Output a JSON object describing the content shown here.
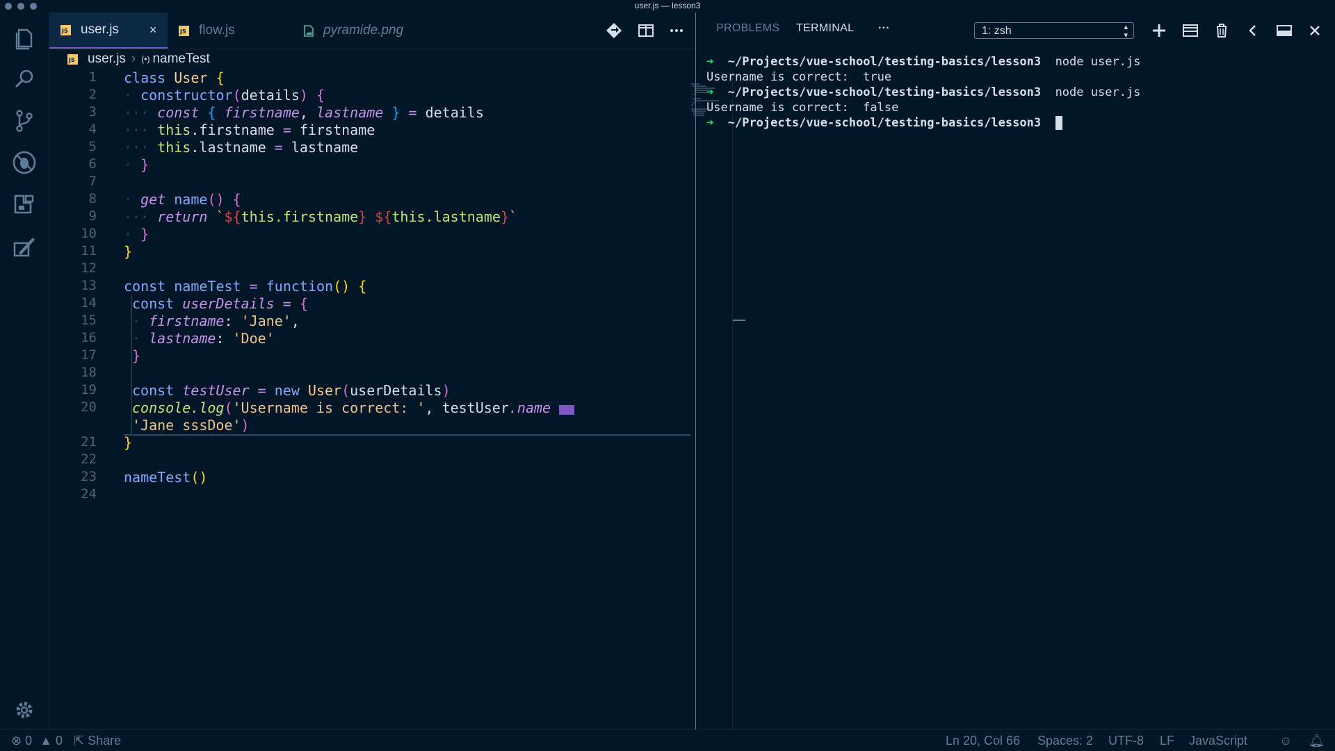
{
  "window": {
    "title": "user.js — lesson3"
  },
  "tabs": [
    {
      "label": "user.js",
      "close": "×"
    },
    {
      "label": "flow.js"
    },
    {
      "label": "pyramide.png"
    }
  ],
  "breadcrumb": {
    "file": "user.js",
    "separator": "›",
    "symbol": "nameTest"
  },
  "gutter": [
    "1",
    "2",
    "3",
    "4",
    "5",
    "6",
    "7",
    "8",
    "9",
    "10",
    "11",
    "12",
    "13",
    "14",
    "15",
    "16",
    "17",
    "18",
    "19",
    "20",
    "",
    "21",
    "22",
    "23",
    "24"
  ],
  "code": {
    "l1": [
      "class",
      "User",
      "{"
    ],
    "l2": [
      "constructor",
      "(",
      "details",
      ")",
      "{"
    ],
    "l3": [
      "const",
      "{",
      "firstname",
      ",",
      "lastname",
      "}",
      "=",
      "details"
    ],
    "l4": [
      "this",
      ".firstname",
      "=",
      "firstname"
    ],
    "l5": [
      "this",
      ".lastname",
      "=",
      "lastname"
    ],
    "l6": [
      "}"
    ],
    "l8": [
      "get",
      "name",
      "()",
      "{"
    ],
    "l9": [
      "return",
      "`",
      "${",
      "this.firstname",
      "}",
      "${",
      "this.lastname",
      "}",
      "`"
    ],
    "l10": [
      "}"
    ],
    "l11": [
      "}"
    ],
    "l13": [
      "const",
      "nameTest",
      "=",
      "function",
      "()",
      "{"
    ],
    "l14": [
      "const",
      "userDetails",
      "=",
      "{"
    ],
    "l15": [
      "firstname",
      ":",
      "'Jane'",
      ","
    ],
    "l16": [
      "lastname",
      ":",
      "'Doe'"
    ],
    "l17": [
      "}"
    ],
    "l19": [
      "const",
      "testUser",
      "=",
      "new",
      "User",
      "(",
      "userDetails",
      ")"
    ],
    "l20": [
      "console",
      ".log",
      "(",
      "'Username is correct: '",
      ",",
      "testUser",
      ".name",
      "==="
    ],
    "l20b": [
      "'Jane sssDoe'",
      ")"
    ],
    "l21": [
      "}"
    ],
    "l23": [
      "nameTest",
      "()"
    ]
  },
  "panel": {
    "tabs": [
      "PROBLEMS",
      "TERMINAL"
    ],
    "more": "···",
    "terminal_select": "1: zsh",
    "lines": [
      {
        "arrow": "➜",
        "path": "~/Projects/vue-school/testing-basics/lesson3",
        "cmd": "node user.js"
      },
      {
        "output": "Username is correct:  true"
      },
      {
        "arrow": "➜",
        "path": "~/Projects/vue-school/testing-basics/lesson3",
        "cmd": "node user.js"
      },
      {
        "output": "Username is correct:  false"
      },
      {
        "arrow": "➜",
        "path": "~/Projects/vue-school/testing-basics/lesson3",
        "cmd": ""
      }
    ]
  },
  "status": {
    "errors": "0",
    "warnings": "0",
    "share": "Share",
    "position": "Ln 20, Col 66",
    "spaces": "Spaces: 2",
    "encoding": "UTF-8",
    "eol": "LF",
    "language": "JavaScript"
  },
  "colors": {
    "background": "#011627",
    "accent": "#7e57c2",
    "terminal_arrow": "#22da6e"
  }
}
